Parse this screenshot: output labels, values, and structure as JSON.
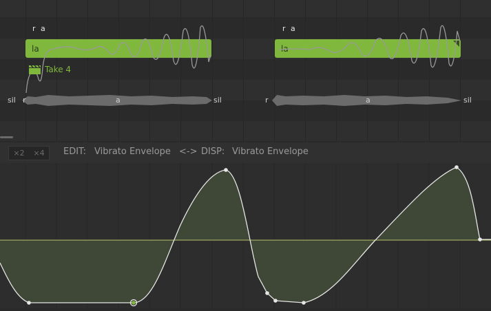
{
  "piano_roll": {
    "notes": [
      {
        "phonemes": "r a",
        "lyric": "la"
      },
      {
        "phonemes": "r a",
        "lyric": "la"
      }
    ],
    "take": {
      "label": "Take 4",
      "icon": "clapperboard-icon"
    },
    "waveform_labels": {
      "segment1": [
        "sil",
        "r",
        "a",
        "sil"
      ],
      "segment2": [
        "r",
        "a",
        "sil"
      ]
    },
    "colors": {
      "note": "#7fb83c",
      "pitch_curve": "#9a9a9a"
    }
  },
  "toolbar": {
    "zoom": [
      "×2",
      "×4"
    ],
    "edit_prefix": "EDIT:",
    "edit_value": "Vibrato Envelope",
    "swap_icon": "<->",
    "disp_prefix": "DISP:",
    "disp_value": "Vibrato Envelope"
  },
  "envelope": {
    "colors": {
      "curve": "#e6e6e6",
      "baseline": "#b9c36a",
      "fill": "#3f4737"
    }
  }
}
